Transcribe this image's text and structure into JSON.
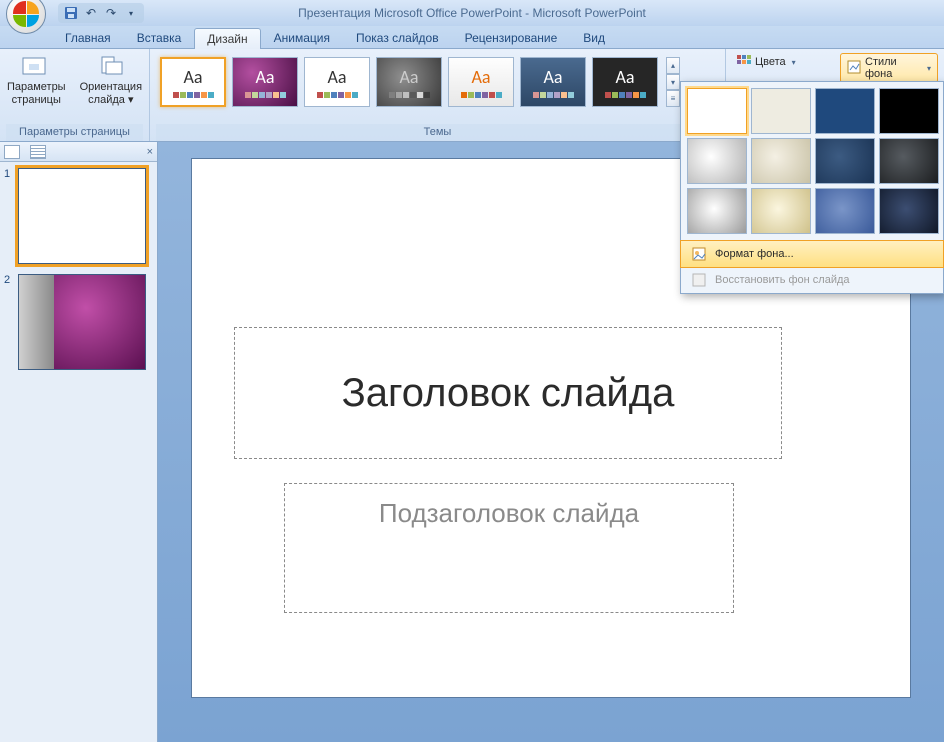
{
  "title": "Презентация Microsoft Office PowerPoint - Microsoft PowerPoint",
  "tabs": {
    "home": "Главная",
    "insert": "Вставка",
    "design": "Дизайн",
    "animation": "Анимация",
    "slideshow": "Показ слайдов",
    "review": "Рецензирование",
    "view": "Вид"
  },
  "ribbon": {
    "pageParamsGroup": "Параметры страницы",
    "pageParamsBtn": "Параметры\nстраницы",
    "orientationBtn": "Ориентация\nслайда ▾",
    "themesGroup": "Темы",
    "themeLabel": "Aa",
    "colorsBtn": "Цвета",
    "bgStylesBtn": "Стили фона"
  },
  "bgPanel": {
    "formatBg": "Формат фона...",
    "restoreBg": "Восстановить фон слайда"
  },
  "slidesPane": {
    "closeChar": "×",
    "thumbs": [
      "1",
      "2"
    ]
  },
  "slide": {
    "title": "Заголовок слайда",
    "subtitle": "Подзаголовок слайда"
  }
}
